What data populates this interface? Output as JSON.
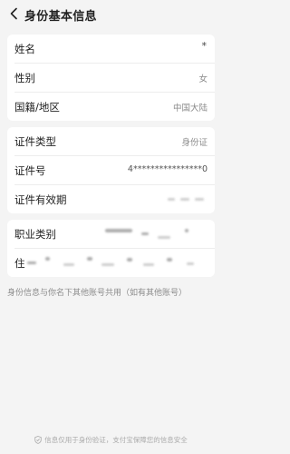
{
  "header": {
    "back_icon": "chevron-left-icon",
    "title": "身份基本信息"
  },
  "basic_card": {
    "rows": [
      {
        "label": "姓名",
        "value": "*"
      },
      {
        "label": "性别",
        "value": "女"
      },
      {
        "label": "国籍/地区",
        "value": "中国大陆"
      }
    ]
  },
  "id_card": {
    "rows": [
      {
        "label": "证件类型",
        "value": "身份证"
      },
      {
        "label": "证件号",
        "value": "4****************0"
      },
      {
        "label": "证件有效期",
        "value": ""
      }
    ]
  },
  "job_card": {
    "rows": [
      {
        "label": "职业类别",
        "value": ""
      },
      {
        "label": "住",
        "value": ""
      }
    ]
  },
  "note": "身份信息与你名下其他账号共用（如有其他账号）",
  "footer": {
    "icon": "shield-icon",
    "text": "信息仅用于身份验证，支付宝保障您的信息安全"
  }
}
